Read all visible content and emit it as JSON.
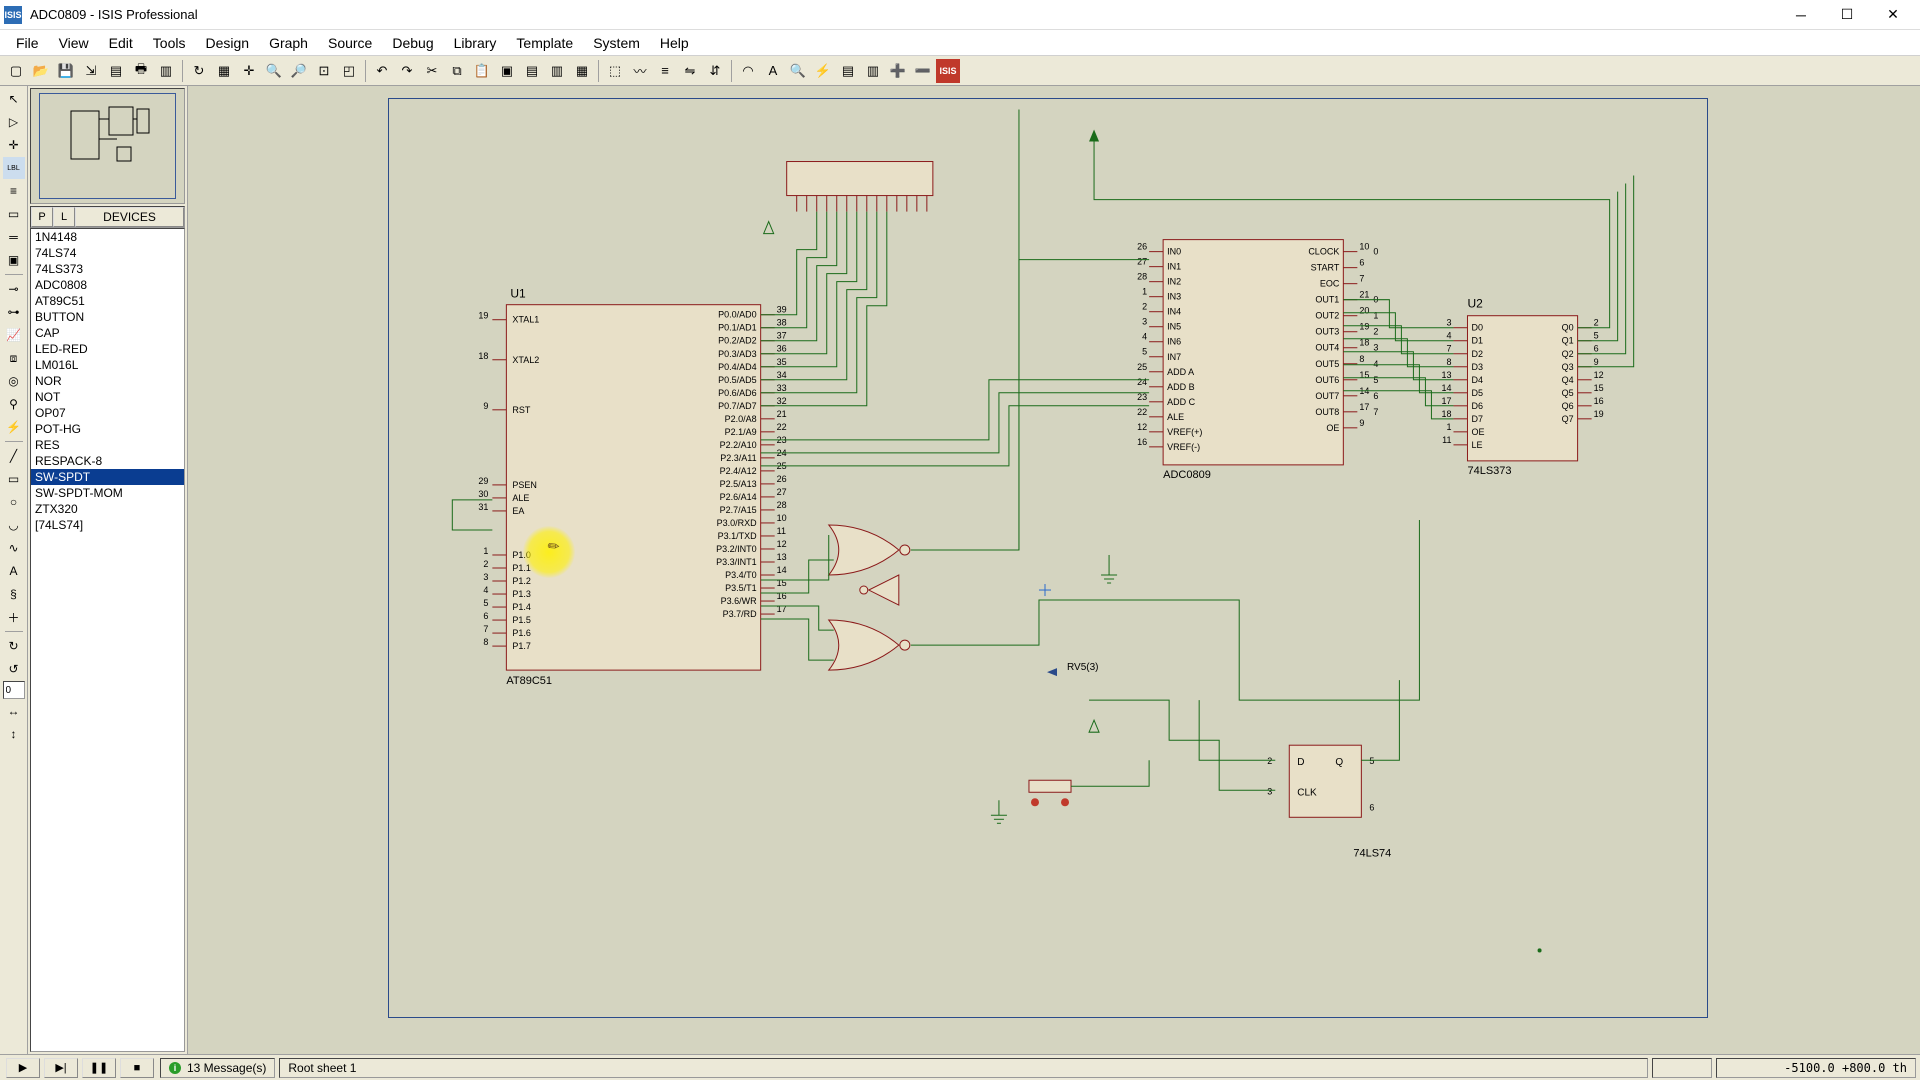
{
  "title": "ADC0809 - ISIS Professional",
  "app_icon": "ISIS",
  "menu": [
    "File",
    "View",
    "Edit",
    "Tools",
    "Design",
    "Graph",
    "Source",
    "Debug",
    "Library",
    "Template",
    "System",
    "Help"
  ],
  "toolbar_icons": [
    "new-file",
    "open-file",
    "save-file",
    "import",
    "section",
    "print",
    "set-area",
    "sep",
    "refresh",
    "grid",
    "origin",
    "zoom-in",
    "zoom-out",
    "zoom-all",
    "zoom-area",
    "sep",
    "undo",
    "redo",
    "cut",
    "copy",
    "paste",
    "block-copy",
    "block-move",
    "block-rotate",
    "block-delete",
    "sep",
    "pick",
    "wire-tool",
    "bus-tool",
    "mirror-h",
    "mirror-v",
    "sep",
    "arc",
    "text-ann",
    "find",
    "electrical-rules",
    "netlist",
    "bom",
    "new-sheet",
    "del-sheet",
    "exit-isis"
  ],
  "vtool_icons": [
    "selection",
    "component",
    "junction",
    "wire-label",
    "lbl",
    "text-script",
    "bus",
    "subcircuit",
    "sep",
    "terminal",
    "device-pin",
    "graph-mode",
    "tape",
    "generator",
    "probe-v",
    "probe-i",
    "sep",
    "line2d",
    "box2d",
    "circle2d",
    "arc2d",
    "path2d",
    "text2d",
    "symbol",
    "plus",
    "sep",
    "rot-cw",
    "rot-ccw",
    "rot-input",
    "mir-h",
    "mir-v"
  ],
  "rotation_value": "0",
  "devices_header": {
    "p": "P",
    "l": "L",
    "title": "DEVICES"
  },
  "devices": [
    "1N4148",
    "74LS74",
    "74LS373",
    "ADC0808",
    "AT89C51",
    "BUTTON",
    "CAP",
    "LED-RED",
    "LM016L",
    "NOR",
    "NOT",
    "OP07",
    "POT-HG",
    "RES",
    "RESPACK-8",
    "SW-SPDT",
    "SW-SPDT-MOM",
    "ZTX320",
    "[74LS74]"
  ],
  "device_selected": 15,
  "chip_u1": {
    "ref": "U1",
    "name": "AT89C51",
    "left_pins": [
      {
        "n": "19",
        "lbl": "XTAL1"
      },
      {
        "n": "18",
        "lbl": "XTAL2"
      },
      {
        "n": "9",
        "lbl": "RST"
      },
      {
        "n": "29",
        "lbl": "PSEN"
      },
      {
        "n": "30",
        "lbl": "ALE"
      },
      {
        "n": "31",
        "lbl": "EA"
      },
      {
        "n": "1",
        "lbl": "P1.0"
      },
      {
        "n": "2",
        "lbl": "P1.1"
      },
      {
        "n": "3",
        "lbl": "P1.2"
      },
      {
        "n": "4",
        "lbl": "P1.3"
      },
      {
        "n": "5",
        "lbl": "P1.4"
      },
      {
        "n": "6",
        "lbl": "P1.5"
      },
      {
        "n": "7",
        "lbl": "P1.6"
      },
      {
        "n": "8",
        "lbl": "P1.7"
      }
    ],
    "right_pins": [
      {
        "n": "39",
        "lbl": "P0.0/AD0"
      },
      {
        "n": "38",
        "lbl": "P0.1/AD1"
      },
      {
        "n": "37",
        "lbl": "P0.2/AD2"
      },
      {
        "n": "36",
        "lbl": "P0.3/AD3"
      },
      {
        "n": "35",
        "lbl": "P0.4/AD4"
      },
      {
        "n": "34",
        "lbl": "P0.5/AD5"
      },
      {
        "n": "33",
        "lbl": "P0.6/AD6"
      },
      {
        "n": "32",
        "lbl": "P0.7/AD7"
      },
      {
        "n": "21",
        "lbl": "P2.0/A8"
      },
      {
        "n": "22",
        "lbl": "P2.1/A9"
      },
      {
        "n": "23",
        "lbl": "P2.2/A10"
      },
      {
        "n": "24",
        "lbl": "P2.3/A11"
      },
      {
        "n": "25",
        "lbl": "P2.4/A12"
      },
      {
        "n": "26",
        "lbl": "P2.5/A13"
      },
      {
        "n": "27",
        "lbl": "P2.6/A14"
      },
      {
        "n": "28",
        "lbl": "P2.7/A15"
      },
      {
        "n": "10",
        "lbl": "P3.0/RXD"
      },
      {
        "n": "11",
        "lbl": "P3.1/TXD"
      },
      {
        "n": "12",
        "lbl": "P3.2/INT0"
      },
      {
        "n": "13",
        "lbl": "P3.3/INT1"
      },
      {
        "n": "14",
        "lbl": "P3.4/T0"
      },
      {
        "n": "15",
        "lbl": "P3.5/T1"
      },
      {
        "n": "16",
        "lbl": "P3.6/WR"
      },
      {
        "n": "17",
        "lbl": "P3.7/RD"
      }
    ]
  },
  "chip_adc": {
    "name": "ADC0809",
    "left_pins": [
      {
        "n": "26",
        "lbl": "IN0"
      },
      {
        "n": "27",
        "lbl": "IN1"
      },
      {
        "n": "28",
        "lbl": "IN2"
      },
      {
        "n": "1",
        "lbl": "IN3"
      },
      {
        "n": "2",
        "lbl": "IN4"
      },
      {
        "n": "3",
        "lbl": "IN5"
      },
      {
        "n": "4",
        "lbl": "IN6"
      },
      {
        "n": "5",
        "lbl": "IN7"
      },
      {
        "n": "25",
        "lbl": "ADD A"
      },
      {
        "n": "24",
        "lbl": "ADD B"
      },
      {
        "n": "23",
        "lbl": "ADD C"
      },
      {
        "n": "22",
        "lbl": "ALE"
      },
      {
        "n": "12",
        "lbl": "VREF(+)"
      },
      {
        "n": "16",
        "lbl": "VREF(-)"
      }
    ],
    "right_pins": [
      {
        "n": "10",
        "lbl": "CLOCK"
      },
      {
        "n": "6",
        "lbl": "START"
      },
      {
        "n": "7",
        "lbl": "EOC"
      },
      {
        "n": "21",
        "lbl": "OUT1"
      },
      {
        "n": "20",
        "lbl": "OUT2"
      },
      {
        "n": "19",
        "lbl": "OUT3"
      },
      {
        "n": "18",
        "lbl": "OUT4"
      },
      {
        "n": "8",
        "lbl": "OUT5"
      },
      {
        "n": "15",
        "lbl": "OUT6"
      },
      {
        "n": "14",
        "lbl": "OUT7"
      },
      {
        "n": "17",
        "lbl": "OUT8"
      },
      {
        "n": "9",
        "lbl": "OE"
      }
    ],
    "right_nums": [
      "0",
      "",
      "",
      "0",
      "1",
      "2",
      "3",
      "4",
      "5",
      "6",
      "7",
      ""
    ]
  },
  "chip_u2": {
    "ref": "U2",
    "name": "74LS373",
    "left_pins": [
      {
        "n": "3",
        "lbl": "D0"
      },
      {
        "n": "4",
        "lbl": "D1"
      },
      {
        "n": "7",
        "lbl": "D2"
      },
      {
        "n": "8",
        "lbl": "D3"
      },
      {
        "n": "13",
        "lbl": "D4"
      },
      {
        "n": "14",
        "lbl": "D5"
      },
      {
        "n": "17",
        "lbl": "D6"
      },
      {
        "n": "18",
        "lbl": "D7"
      },
      {
        "n": "1",
        "lbl": "OE"
      },
      {
        "n": "11",
        "lbl": "LE"
      }
    ],
    "right_pins": [
      {
        "n": "2",
        "lbl": "Q0"
      },
      {
        "n": "5",
        "lbl": "Q1"
      },
      {
        "n": "6",
        "lbl": "Q2"
      },
      {
        "n": "9",
        "lbl": "Q3"
      },
      {
        "n": "12",
        "lbl": "Q4"
      },
      {
        "n": "15",
        "lbl": "Q5"
      },
      {
        "n": "16",
        "lbl": "Q6"
      },
      {
        "n": "19",
        "lbl": "Q7"
      }
    ]
  },
  "chip_ff": {
    "name": "74LS74",
    "left": [
      {
        "n": "2",
        "lbl": "D"
      },
      {
        "n": "3",
        "lbl": "CLK"
      }
    ],
    "right": [
      {
        "n": "5",
        "lbl": "Q"
      },
      {
        "n": "6",
        "lbl": "Q"
      }
    ]
  },
  "label_rv": "RV5(3)",
  "status": {
    "messages": "13 Message(s)",
    "sheet": "Root sheet 1",
    "coords": "-5100.0   +800.0   th"
  }
}
